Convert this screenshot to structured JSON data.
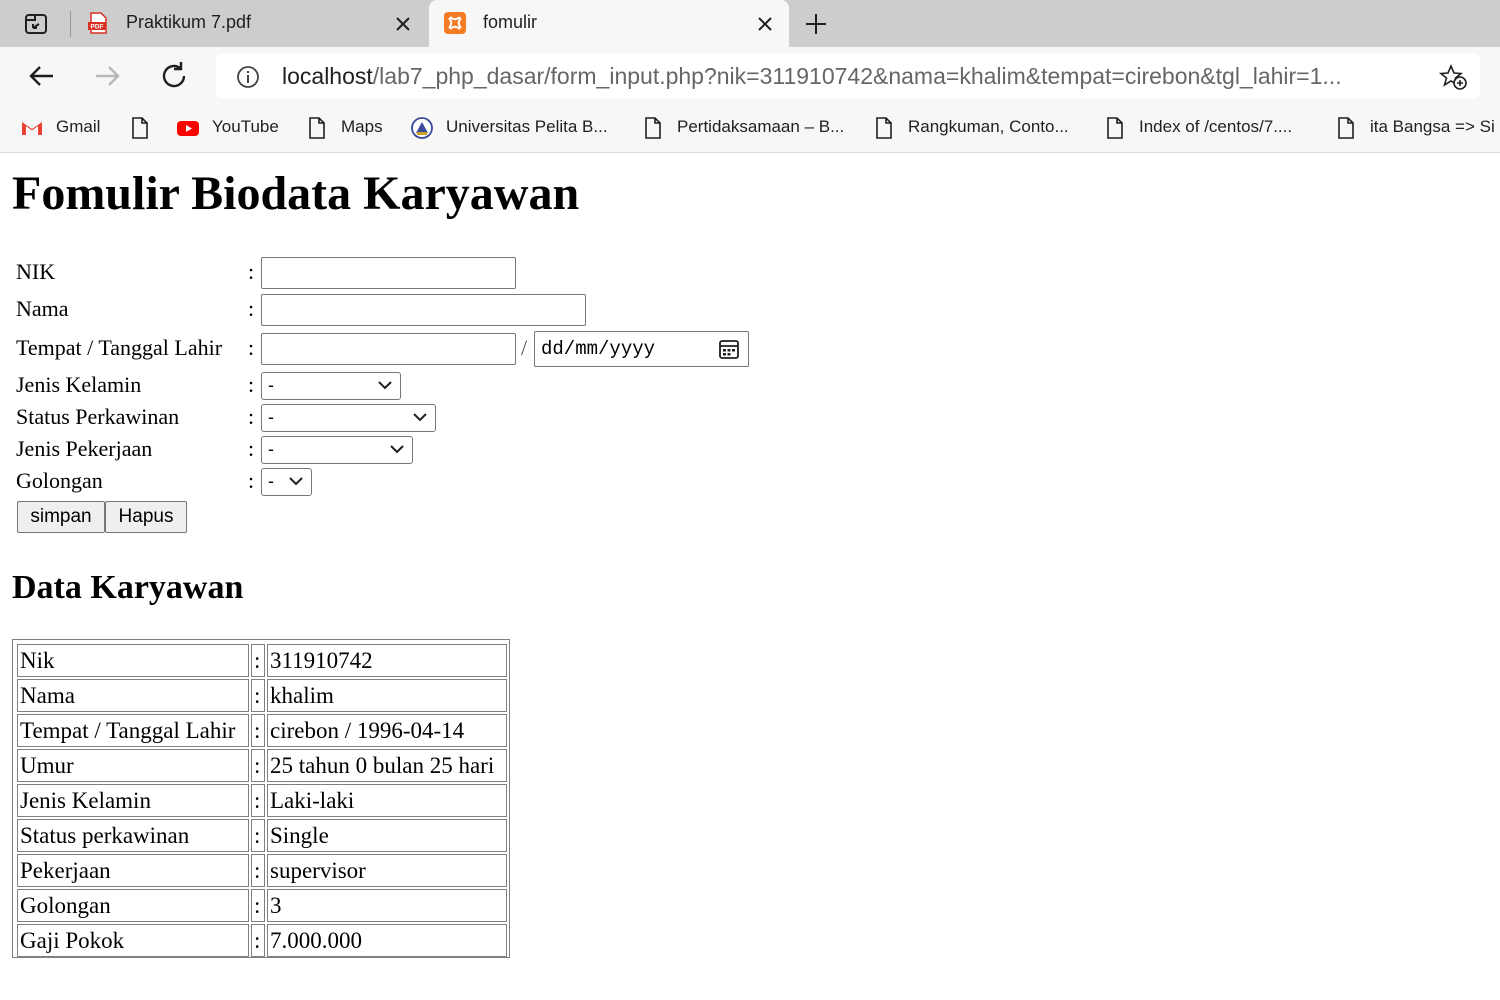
{
  "browser": {
    "tabs": [
      {
        "title": "Praktikum 7.pdf",
        "icon": "pdf-icon",
        "active": false
      },
      {
        "title": "fomulir",
        "icon": "xampp-icon",
        "active": true
      }
    ],
    "url_host": "localhost",
    "url_path": "/lab7_php_dasar/form_input.php?nik=311910742&nama=khalim&tempat=cirebon&tgl_lahir=1...",
    "bookmarks": [
      {
        "label": "Gmail",
        "icon": "gmail-icon"
      },
      {
        "label": "",
        "icon": "page-icon"
      },
      {
        "label": "YouTube",
        "icon": "youtube-icon"
      },
      {
        "label": "Maps",
        "icon": "page-icon"
      },
      {
        "label": "Universitas Pelita B...",
        "icon": "university-icon"
      },
      {
        "label": "Pertidaksamaan – B...",
        "icon": "page-icon"
      },
      {
        "label": "Rangkuman, Conto...",
        "icon": "page-icon"
      },
      {
        "label": "Index of /centos/7....",
        "icon": "page-icon"
      },
      {
        "label": "ita Bangsa => Si",
        "icon": "page-icon"
      }
    ]
  },
  "form": {
    "title": "Fomulir Biodata Karyawan",
    "colon": ":",
    "separator": "/",
    "fields": {
      "nik": {
        "label": "NIK",
        "value": ""
      },
      "nama": {
        "label": "Nama",
        "value": ""
      },
      "tempat_tanggal": {
        "label": "Tempat / Tanggal Lahir",
        "value": "",
        "date_placeholder": "dd/mm/yyyy"
      },
      "jenis_kelamin": {
        "label": "Jenis Kelamin",
        "selected": "-"
      },
      "status_perkawinan": {
        "label": "Status Perkawinan",
        "selected": "-"
      },
      "jenis_pekerjaan": {
        "label": "Jenis Pekerjaan",
        "selected": "-"
      },
      "golongan": {
        "label": "Golongan",
        "selected": "-"
      }
    },
    "buttons": {
      "simpan": "simpan",
      "hapus": "Hapus"
    }
  },
  "data_section": {
    "title": "Data Karyawan",
    "rows": [
      {
        "label": "Nik",
        "colon": ":",
        "value": "311910742"
      },
      {
        "label": "Nama",
        "colon": ":",
        "value": "khalim"
      },
      {
        "label": "Tempat / Tanggal Lahir",
        "colon": ":",
        "value": "cirebon / 1996-04-14"
      },
      {
        "label": "Umur",
        "colon": ":",
        "value": "25 tahun 0 bulan 25 hari"
      },
      {
        "label": "Jenis Kelamin",
        "colon": ":",
        "value": "Laki-laki"
      },
      {
        "label": "Status perkawinan",
        "colon": ":",
        "value": "Single"
      },
      {
        "label": "Pekerjaan",
        "colon": ":",
        "value": "supervisor"
      },
      {
        "label": "Golongan",
        "colon": ":",
        "value": "3"
      },
      {
        "label": "Gaji Pokok",
        "colon": ":",
        "value": "7.000.000"
      }
    ]
  },
  "colors": {
    "tabstrip": "#cdcdcd",
    "toolbar": "#f7f7f7",
    "pdf_red": "#d93025",
    "xampp_orange": "#f57c22",
    "youtube_red": "#ff0000"
  }
}
